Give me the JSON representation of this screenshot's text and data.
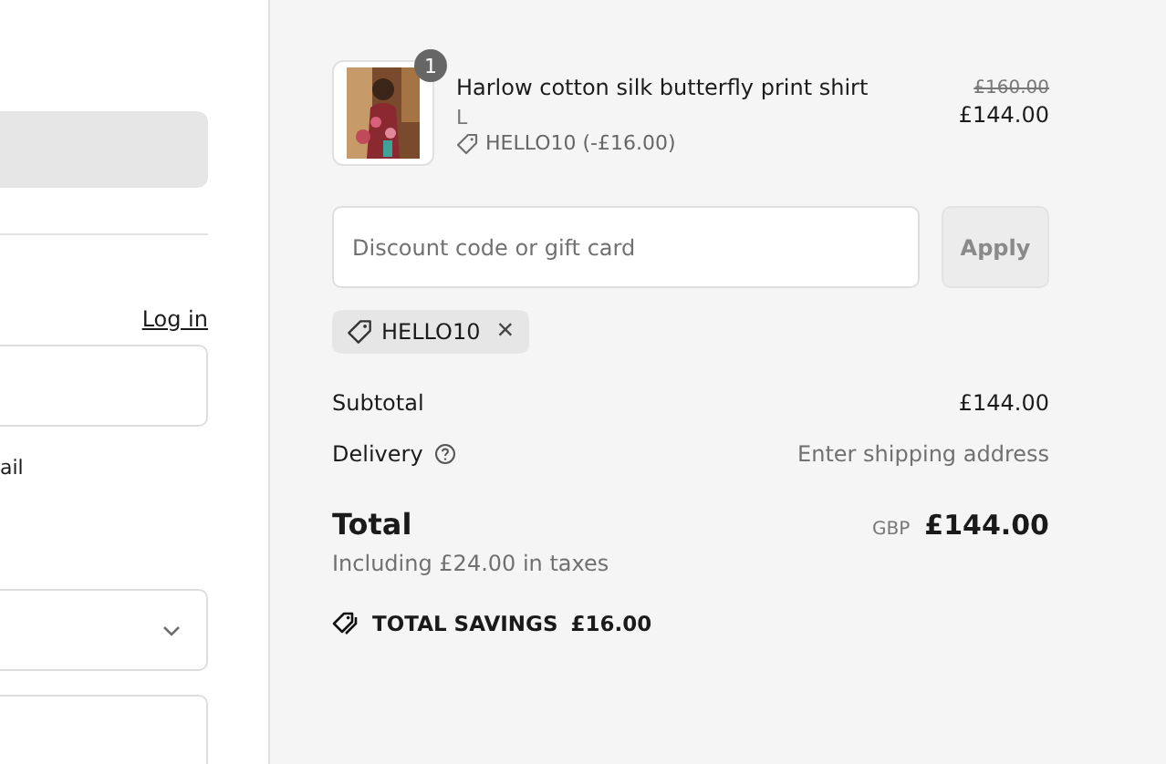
{
  "checkout_form": {
    "login_link": "Log in",
    "marketing_checkbox_label": "ail"
  },
  "order_summary": {
    "items": [
      {
        "name": "Harlow cotton silk butterfly print shirt",
        "variant": "L",
        "quantity": "1",
        "discount": "HELLO10 (-£16.00)",
        "original_price": "£160.00",
        "price": "£144.00"
      }
    ],
    "discount_field": {
      "placeholder": "Discount code or gift card"
    },
    "apply_button": {
      "label": "Apply",
      "disabled": true
    },
    "applied_codes": [
      {
        "code": "HELLO10",
        "remove": "×"
      }
    ],
    "lines": [
      {
        "label": "Subtotal",
        "value": "£144.00",
        "help": false
      },
      {
        "label": "Delivery",
        "value": "Enter shipping address",
        "help": true
      }
    ],
    "total": {
      "label": "Total",
      "currency": "GBP",
      "amount": "£144.00",
      "taxes_note": "Including £24.00 in taxes"
    },
    "savings": {
      "label": "TOTAL SAVINGS",
      "amount": "£16.00"
    }
  }
}
